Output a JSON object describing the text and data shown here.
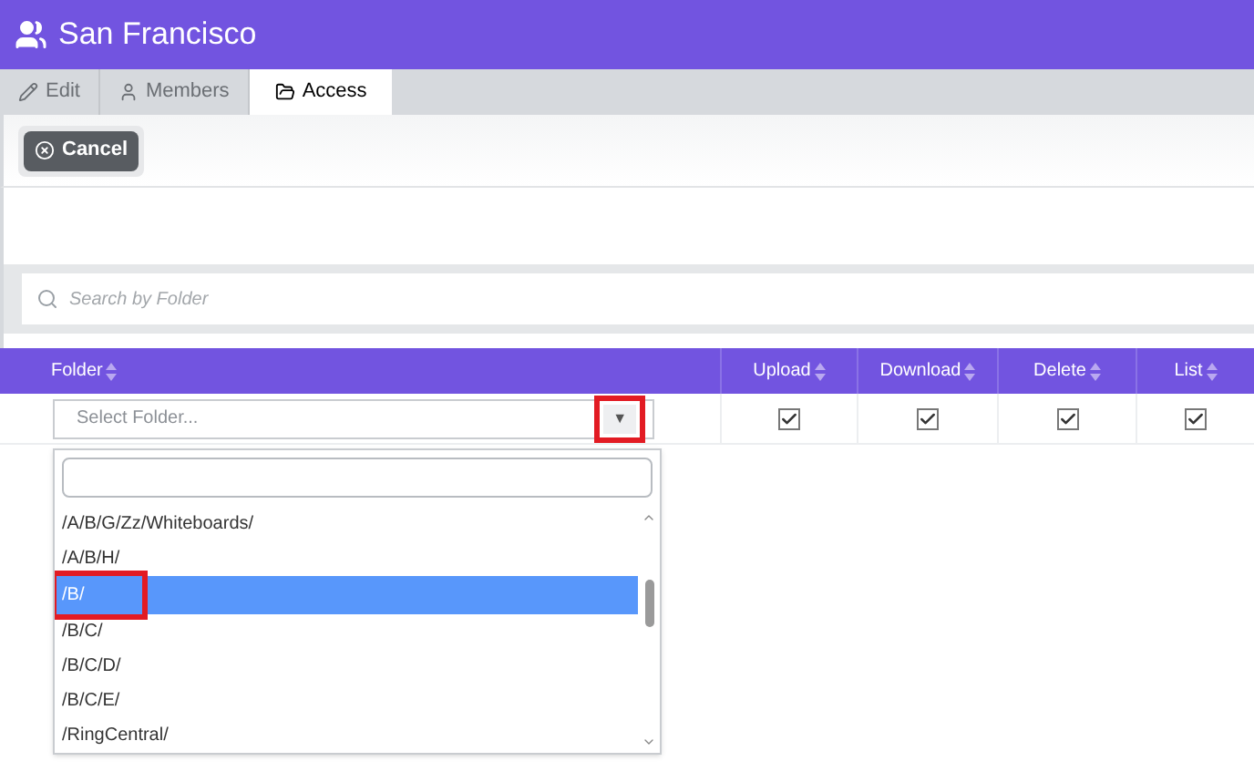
{
  "header": {
    "title": "San Francisco"
  },
  "tabs": [
    {
      "label": "Edit",
      "selected": false
    },
    {
      "label": "Members",
      "selected": false
    },
    {
      "label": "Access",
      "selected": true
    }
  ],
  "toolbar": {
    "cancel_button": "Cancel"
  },
  "search": {
    "placeholder": "Search by Folder"
  },
  "table": {
    "columns": [
      "Folder",
      "Upload",
      "Download",
      "Delete",
      "List"
    ],
    "rows": [
      {
        "folder_select": {
          "placeholder": "Select Folder...",
          "caret": "▼",
          "caret_highlighted": true
        },
        "permissions": [
          {
            "checked": true
          },
          {
            "checked": true
          },
          {
            "checked": true
          },
          {
            "checked": true
          }
        ]
      }
    ]
  },
  "dropdown": {
    "options": [
      {
        "label": "/A/B/G/Zz/Whiteboards/",
        "selected": false,
        "highlighted": false
      },
      {
        "label": "/A/B/H/",
        "selected": false,
        "highlighted": false
      },
      {
        "label": "/B/",
        "selected": true,
        "highlighted": true
      },
      {
        "label": "/B/C/",
        "selected": false,
        "highlighted": false
      },
      {
        "label": "/B/C/D/",
        "selected": false,
        "highlighted": false
      },
      {
        "label": "/B/C/E/",
        "selected": false,
        "highlighted": false
      },
      {
        "label": "/RingCentral/",
        "selected": false,
        "highlighted": false
      }
    ]
  }
}
